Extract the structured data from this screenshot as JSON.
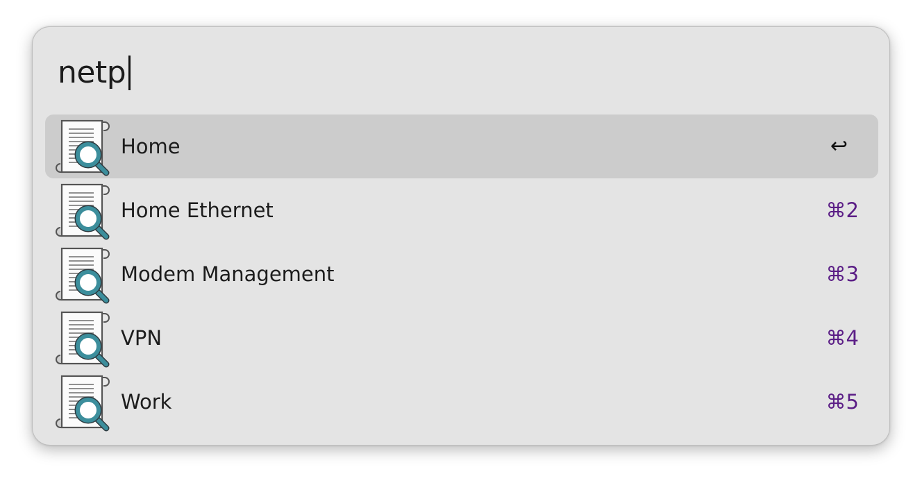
{
  "search": {
    "query": "netp"
  },
  "results": [
    {
      "title": "Home",
      "shortcut": "↩",
      "selected": true,
      "icon": "document-search-icon"
    },
    {
      "title": "Home Ethernet",
      "shortcut": "⌘2",
      "selected": false,
      "icon": "document-search-icon"
    },
    {
      "title": "Modem Management",
      "shortcut": "⌘3",
      "selected": false,
      "icon": "document-search-icon"
    },
    {
      "title": "VPN",
      "shortcut": "⌘4",
      "selected": false,
      "icon": "document-search-icon"
    },
    {
      "title": "Work",
      "shortcut": "⌘5",
      "selected": false,
      "icon": "document-search-icon"
    }
  ],
  "colors": {
    "panel_background": "#e4e4e4",
    "selected_row": "#cccccc",
    "shortcut_text": "#5b1e86",
    "magnifier_lens": "#3c8e9c"
  }
}
